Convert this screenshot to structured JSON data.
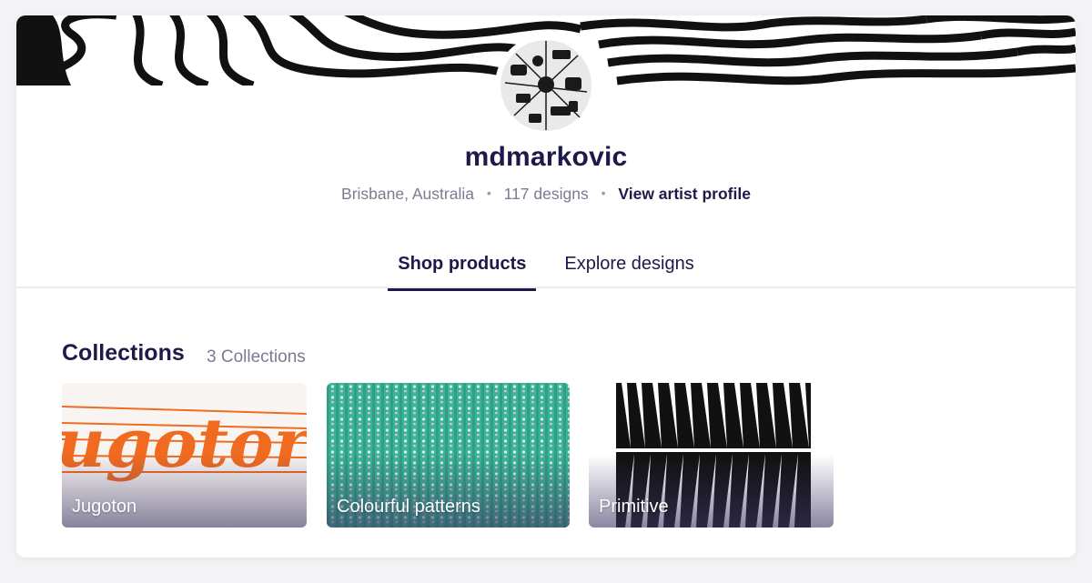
{
  "artist": {
    "username": "mdmarkovic",
    "location": "Brisbane, Australia",
    "designs_count": "117 designs",
    "separator": "•",
    "profile_link": "View artist profile"
  },
  "tabs": [
    {
      "label": "Shop products",
      "active": true
    },
    {
      "label": "Explore designs",
      "active": false
    }
  ],
  "collections": {
    "title": "Collections",
    "count": "3 Collections",
    "items": [
      {
        "label": "Jugoton",
        "art_text": "ugotor"
      },
      {
        "label": "Colourful patterns"
      },
      {
        "label": "Primitive"
      }
    ]
  },
  "colors": {
    "text_primary": "#1d1a4a",
    "text_secondary": "#7b7a92",
    "jugoton_orange": "#f06a1f",
    "pattern_teal": "#38b394"
  }
}
